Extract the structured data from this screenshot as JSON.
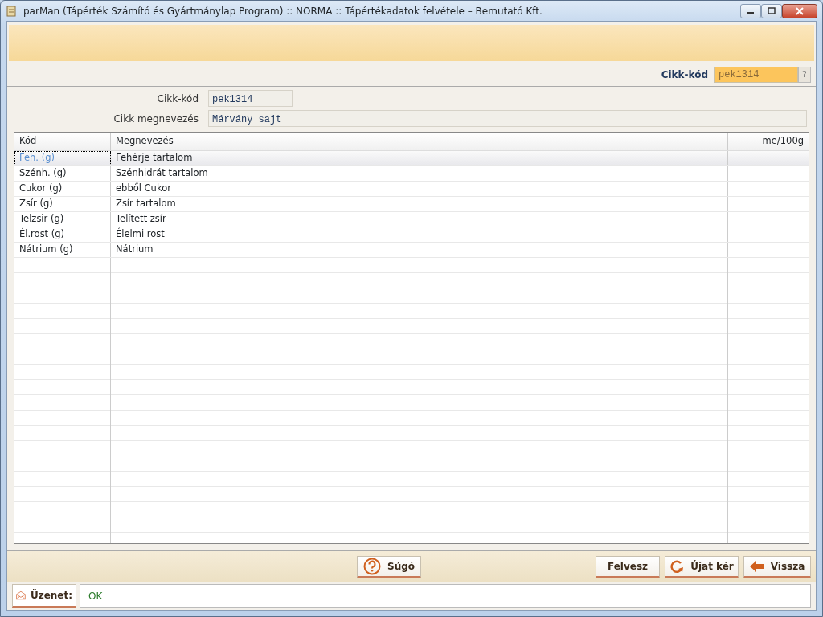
{
  "window": {
    "title": "parMan (Tápérték Számító és Gyártmánylap Program) :: NORMA :: Tápértékadatok felvétele    –   Bemutató Kft."
  },
  "lookup": {
    "label": "Cikk-kód",
    "value": "pek1314",
    "help": "?"
  },
  "info": [
    {
      "label": "Cikk-kód",
      "value": "pek1314"
    },
    {
      "label": "Cikk megnevezés",
      "value": "Márvány sajt"
    }
  ],
  "table": {
    "columns": [
      "Kód",
      "Megnevezés",
      "me/100g"
    ],
    "rows": [
      {
        "code": "Feh. (g)",
        "name": "Fehérje tartalom",
        "selected": true
      },
      {
        "code": "Szénh. (g)",
        "name": "Szénhidrát tartalom",
        "selected": false
      },
      {
        "code": "Cukor (g)",
        "name": "ebből Cukor",
        "selected": false
      },
      {
        "code": "Zsír (g)",
        "name": "Zsír tartalom",
        "selected": false
      },
      {
        "code": "Telzsir (g)",
        "name": "Telített zsír",
        "selected": false
      },
      {
        "code": "Él.rost (g)",
        "name": "Élelmi rost",
        "selected": false
      },
      {
        "code": "Nátrium (g)",
        "name": "Nátrium",
        "selected": false
      }
    ]
  },
  "buttons": [
    {
      "kind": "help",
      "label": "Súgó"
    },
    {
      "kind": "plain",
      "label": "Felvesz"
    },
    {
      "kind": "refresh",
      "label": "Újat kér"
    },
    {
      "kind": "back",
      "label": "Vissza"
    }
  ],
  "status": {
    "label": "Üzenet:",
    "message": "OK"
  }
}
